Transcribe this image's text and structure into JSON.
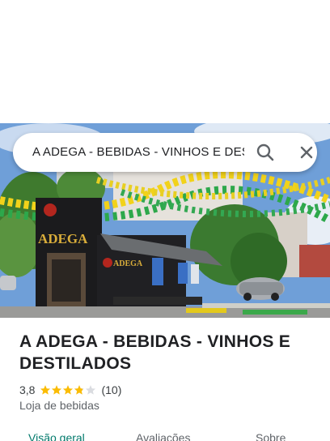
{
  "search": {
    "query": "A ADEGA - BEBIDAS - VINHOS E DESTILADOS",
    "search_icon": "search-icon",
    "close_icon": "close-icon"
  },
  "photo": {
    "sign_text": "ADEGA",
    "sign_small_text": "A",
    "awning_text": "ADEGA"
  },
  "place": {
    "title": "A ADEGA - BEBIDAS - VINHOS E DESTILADOS",
    "rating": "3,8",
    "stars": 3.8,
    "review_count": "(10)",
    "category": "Loja de bebidas"
  },
  "tabs": [
    {
      "label": "Visão geral",
      "active": true
    },
    {
      "label": "Avaliações",
      "active": false
    },
    {
      "label": "Sobre",
      "active": false
    }
  ],
  "colors": {
    "accent": "#00796b",
    "star": "#fbbc04",
    "star_empty": "#dadce0"
  }
}
